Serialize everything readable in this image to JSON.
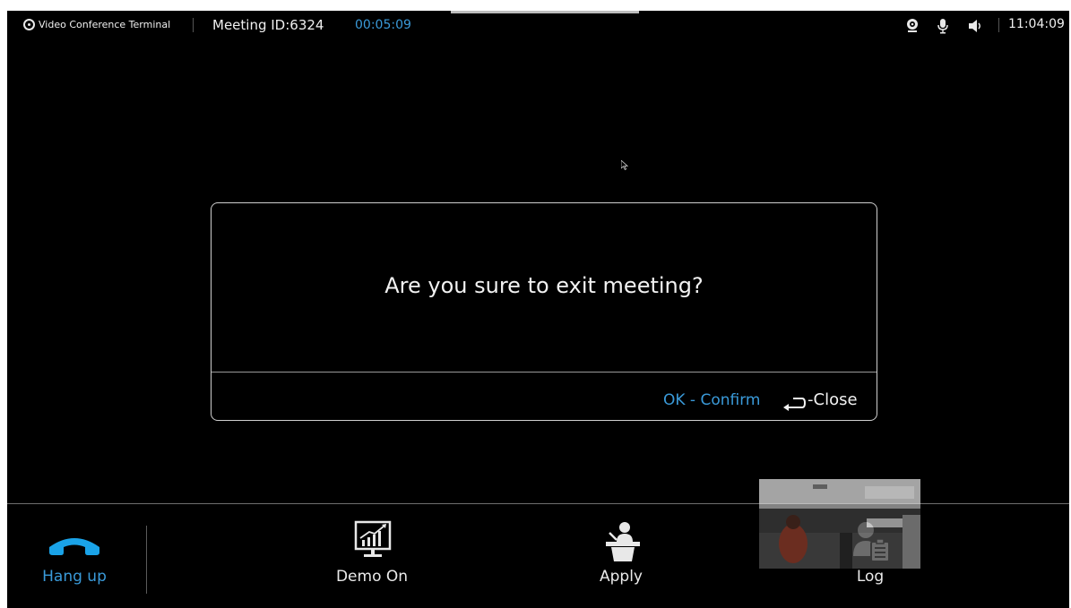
{
  "status_bar": {
    "app_name": "Video Conference Terminal",
    "meeting_id": "Meeting ID:6324",
    "timer": "00:05:09",
    "clock": "11:04:09",
    "icons": [
      "camera-icon",
      "microphone-icon",
      "speaker-icon"
    ]
  },
  "dialog": {
    "message": "Are you sure to exit meeting?",
    "ok_label": "OK - Confirm",
    "close_label": "-Close"
  },
  "toolbar": {
    "hangup_label": "Hang up",
    "demo_label": "Demo On",
    "apply_label": "Apply",
    "log_label": "Log"
  },
  "colors": {
    "accent": "#3a9ad9",
    "background": "#000000",
    "text": "#f2f2f2"
  }
}
